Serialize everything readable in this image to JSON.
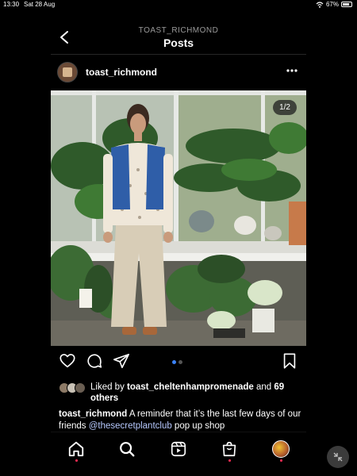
{
  "status_bar": {
    "time": "13:30",
    "date": "Sat 28 Aug",
    "battery": "67%"
  },
  "header": {
    "account": "TOAST_RICHMOND",
    "title": "Posts"
  },
  "post": {
    "username": "toast_richmond",
    "image_counter": "1/2",
    "carousel_position": 1,
    "carousel_total": 2,
    "likes_prefix": "Liked by ",
    "liked_by_user": "toast_cheltenhampromenade",
    "likes_and": " and ",
    "likes_others": "69 others",
    "caption_user": "toast_richmond",
    "caption_text_1": " A reminder that it’s the last few days of our friends ",
    "caption_mention": "@thesecretplantclub",
    "caption_text_2": " pop up shop"
  },
  "icons": {
    "back": "back-arrow-icon",
    "more": "more-options-icon",
    "like": "heart-icon",
    "comment": "comment-icon",
    "share": "send-icon",
    "save": "bookmark-icon",
    "home": "home-icon",
    "search": "search-icon",
    "reels": "reels-icon",
    "shop": "shop-bag-icon",
    "profile": "profile-avatar",
    "collapse": "collapse-icon"
  },
  "colors": {
    "accent_dot": "#3b82f6",
    "notification_dot": "#ff2d55",
    "mention": "#b7c9ff"
  }
}
